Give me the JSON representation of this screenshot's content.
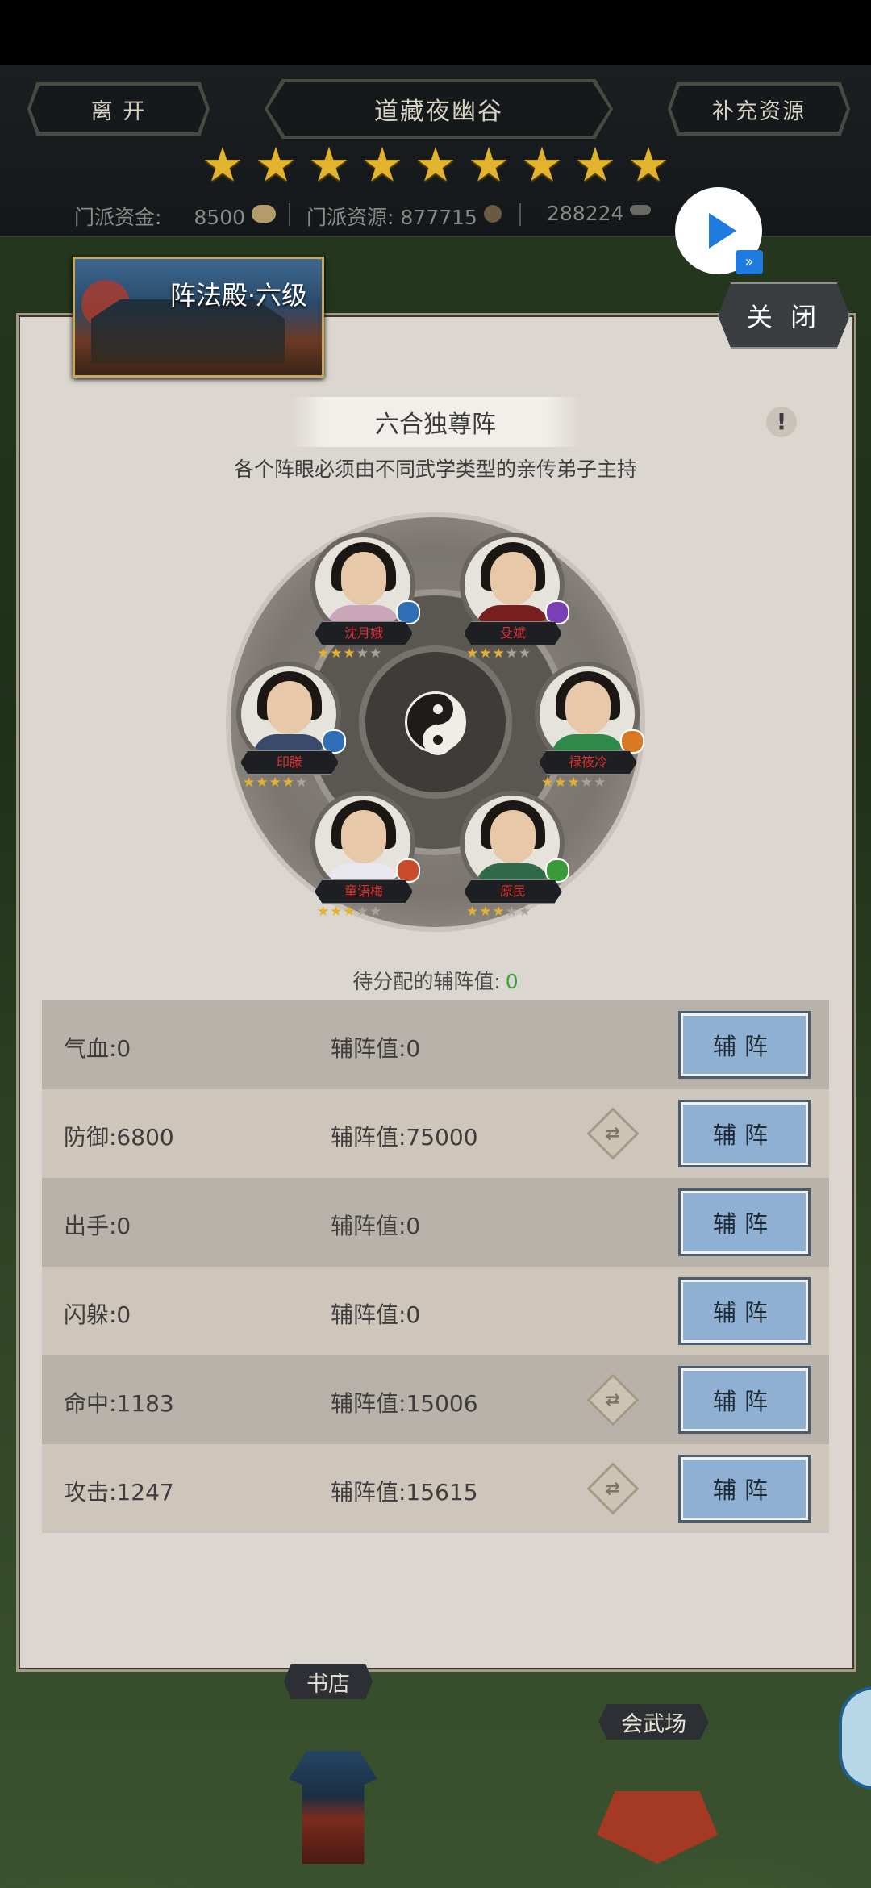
{
  "topbar": {
    "leave_label": "离 开",
    "location_title": "道藏夜幽谷",
    "replenish_label": "补充资源",
    "star_count": 9,
    "sect_funds_label": "门派资金:",
    "sect_funds_value": "8500",
    "sect_resources_label": "门派资源:",
    "sect_resources_value": "877715",
    "third_resource_value": "288224"
  },
  "panel": {
    "hall_title": "阵法殿·六级",
    "close_label": "关 闭",
    "formation_name": "六合独尊阵",
    "info_symbol": "!",
    "subtitle": "各个阵眼必须由不同武学类型的亲传弟子主持",
    "pending_label": "待分配的辅阵值:",
    "pending_value": "0"
  },
  "heroes": [
    {
      "name": "沈月娥",
      "stars": 3,
      "element_color": "#2f6fb5",
      "clothing": "#c9a7b8"
    },
    {
      "name": "殳斌",
      "stars": 3,
      "element_color": "#7a3fb5",
      "clothing": "#7a1f1f"
    },
    {
      "name": "印滕",
      "stars": 4,
      "element_color": "#2f6fb5",
      "clothing": "#3a4a6a"
    },
    {
      "name": "禄筱冷",
      "stars": 3,
      "element_color": "#d87a24",
      "clothing": "#2f8a4a"
    },
    {
      "name": "童语梅",
      "stars": 3,
      "element_color": "#c74a2a",
      "clothing": "#e8e8ee"
    },
    {
      "name": "原民",
      "stars": 3,
      "element_color": "#3a9a3a",
      "clothing": "#2f6a4a"
    }
  ],
  "star_symbol": "★",
  "stats": [
    {
      "stat": "气血:0",
      "assist": "辅阵值:0",
      "has_swap": false,
      "button": "辅阵"
    },
    {
      "stat": "防御:6800",
      "assist": "辅阵值:75000",
      "has_swap": true,
      "button": "辅阵"
    },
    {
      "stat": "出手:0",
      "assist": "辅阵值:0",
      "has_swap": false,
      "button": "辅阵"
    },
    {
      "stat": "闪躲:0",
      "assist": "辅阵值:0",
      "has_swap": false,
      "button": "辅阵"
    },
    {
      "stat": "命中:1183",
      "assist": "辅阵值:15006",
      "has_swap": true,
      "button": "辅阵"
    },
    {
      "stat": "攻击:1247",
      "assist": "辅阵值:15615",
      "has_swap": true,
      "button": "辅阵"
    }
  ],
  "map": {
    "bookstore_label": "书店",
    "arena_label": "会武场"
  },
  "colors": {
    "star_gold": "#e2b32c",
    "button_blue": "#8fb0d2",
    "pending_green": "#3aa23a",
    "nameplate_red": "#d33"
  }
}
